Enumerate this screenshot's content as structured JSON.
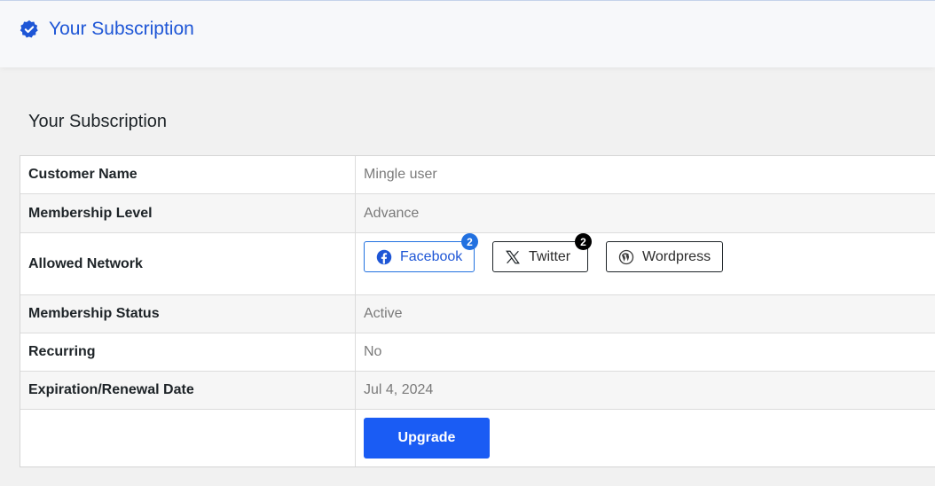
{
  "header": {
    "title": "Your Subscription",
    "icon": "verified-badge-icon",
    "accent": "#1e56d6"
  },
  "section": {
    "title": "Your Subscription"
  },
  "rows": [
    {
      "label": "Customer Name",
      "value": "Mingle user"
    },
    {
      "label": "Membership Level",
      "value": "Advance"
    },
    {
      "label": "Allowed Network"
    },
    {
      "label": "Membership Status",
      "value": "Active"
    },
    {
      "label": "Recurring",
      "value": "No"
    },
    {
      "label": "Expiration/Renewal Date",
      "value": "Jul 4, 2024"
    }
  ],
  "networks": [
    {
      "label": "Facebook",
      "icon": "facebook-icon",
      "count": "2",
      "color": "#2271e0"
    },
    {
      "label": "Twitter",
      "icon": "x-twitter-icon",
      "count": "2",
      "color": "#000000"
    },
    {
      "label": "Wordpress",
      "icon": "wordpress-icon"
    }
  ],
  "actions": {
    "upgrade_label": "Upgrade",
    "upgrade_color": "#1a5cf4"
  }
}
